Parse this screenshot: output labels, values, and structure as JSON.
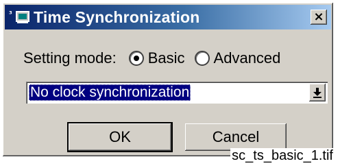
{
  "window": {
    "title": "Time Synchronization",
    "icon_label": "³",
    "close_label": "×"
  },
  "mode": {
    "label": "Setting mode:",
    "options": [
      {
        "label": "Basic",
        "selected": true
      },
      {
        "label": "Advanced",
        "selected": false
      }
    ]
  },
  "sync_select": {
    "value": "No clock synchronization"
  },
  "buttons": {
    "ok": "OK",
    "cancel": "Cancel"
  },
  "caption": "sc_ts_basic_1.tif",
  "colors": {
    "titlebar_start": "#0a246a",
    "titlebar_end": "#a6caf0",
    "face": "#d4d0c8",
    "selection": "#000080"
  }
}
